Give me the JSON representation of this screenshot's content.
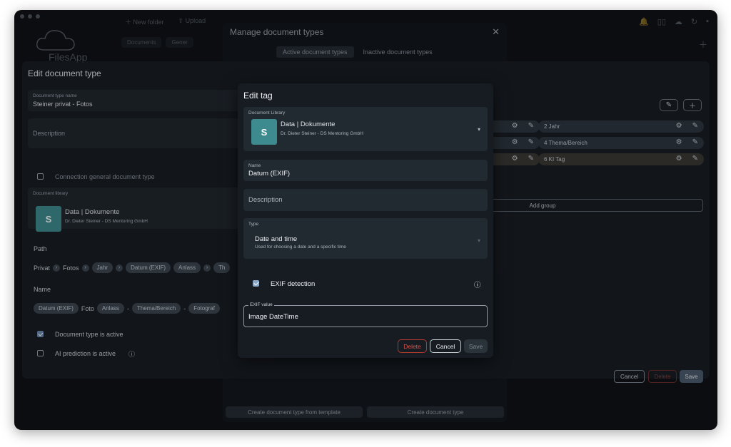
{
  "background": {
    "app_name": "FilesApp",
    "toolbar": {
      "new_folder": "New folder",
      "upload": "Upload"
    },
    "tabs": [
      "Documents",
      "Gener"
    ]
  },
  "manage": {
    "title": "Manage document types",
    "tab_active": "Active document types",
    "tab_inactive": "Inactive document types",
    "btn_template": "Create document type from template",
    "btn_create": "Create document type"
  },
  "edit_type": {
    "title": "Edit document type",
    "name_label": "Document type name",
    "name_value": "Steiner privat - Fotos",
    "description_placeholder": "Description",
    "connection_label": "Connection general document type",
    "library_label": "Document library",
    "library_title": "Data | Dokumente",
    "library_sub": "Dr. Dieter Steiner - DS Mentoring GmbH",
    "path_label": "Path",
    "path_privat": "Privat",
    "path_fotos": "Fotos",
    "path_chips": [
      "Jahr",
      "Datum (EXIF)",
      "Anlass",
      "Th"
    ],
    "name_label2": "Name",
    "name_chip1": "Datum (EXIF)",
    "name_foto": "Foto",
    "name_chips": [
      "Anlass",
      "Thema/Bereich",
      "Fotograf"
    ],
    "name_dash": "-",
    "active_label": "Document type is active",
    "ai_label": "AI prediction is active",
    "tags": [
      {
        "label": "2   Jahr"
      },
      {
        "label": "4   Thema/Bereich"
      },
      {
        "label": "6   KI Tag"
      }
    ],
    "add_group": "Add group",
    "btn_cancel": "Cancel",
    "btn_delete": "Delete",
    "btn_save": "Save"
  },
  "dialog": {
    "title": "Edit tag",
    "library_label": "Document Library",
    "library_title": "Data | Dokumente",
    "library_sub": "Dr. Dieter Steiner - DS Mentoring GmbH",
    "name_label": "Name",
    "name_value": "Datum (EXIF)",
    "description_placeholder": "Description",
    "type_label": "Type",
    "type_value": "Date and time",
    "type_sub": "Used for choosing a date and a specific time",
    "exif_detection_label": "EXIF detection",
    "exif_value_label": "EXIF value",
    "exif_value": "Image DateTime",
    "btn_delete": "Delete",
    "btn_cancel": "Cancel",
    "btn_save": "Save"
  },
  "colors": {
    "delete_red": "#c0392b",
    "checkbox_blue": "#6b8bb0",
    "sharepoint_teal": "#3d8b8e"
  }
}
